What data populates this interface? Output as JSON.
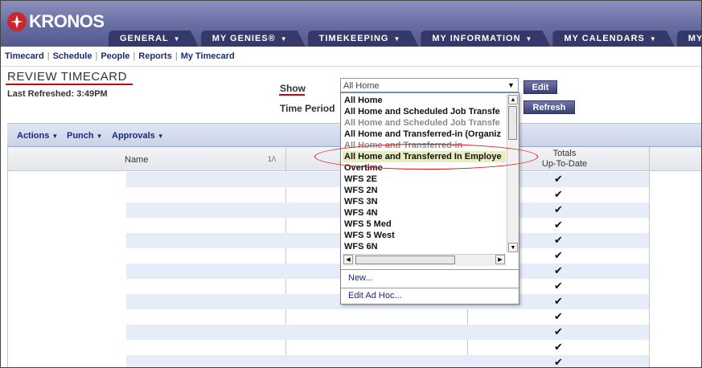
{
  "header": {
    "logo_text": "KRONOS",
    "tabs": [
      {
        "label": "GENERAL"
      },
      {
        "label": "MY GENIES®"
      },
      {
        "label": "TIMEKEEPING"
      },
      {
        "label": "MY INFORMATION"
      },
      {
        "label": "MY CALENDARS"
      },
      {
        "label": "MY LINKS"
      }
    ]
  },
  "subnav": {
    "links": [
      "Timecard",
      "Schedule",
      "People",
      "Reports",
      "My Timecard"
    ]
  },
  "page": {
    "title": "REVIEW TIMECARD",
    "last_refreshed": "Last Refreshed: 3:49PM",
    "show_label": "Show",
    "time_period_label": "Time Period",
    "show_value": "All Home",
    "edit_button": "Edit",
    "refresh_button": "Refresh"
  },
  "toolbar": {
    "actions": "Actions",
    "punch": "Punch",
    "approvals": "Approvals"
  },
  "grid": {
    "name_header": "Name",
    "sort_indicator": "1/\\",
    "totals_line1": "Totals",
    "totals_line2": "Up-To-Date",
    "check_glyph": "✔"
  },
  "dropdown": {
    "items": [
      {
        "label": "All Home",
        "state": "normal"
      },
      {
        "label": "All Home and Scheduled Job Transfe",
        "state": "normal"
      },
      {
        "label": "All Home and Scheduled Job Transfe",
        "state": "dim"
      },
      {
        "label": "All Home and Transferred-in (Organiz",
        "state": "normal"
      },
      {
        "label": "All Home and Transferred-in",
        "state": "dim"
      },
      {
        "label": "All Home and Transferred In Employe",
        "state": "selected"
      },
      {
        "label": "Overtime",
        "state": "normal"
      },
      {
        "label": "WFS 2E",
        "state": "normal"
      },
      {
        "label": "WFS 2N",
        "state": "normal"
      },
      {
        "label": "WFS 3N",
        "state": "normal"
      },
      {
        "label": "WFS 4N",
        "state": "normal"
      },
      {
        "label": "WFS 5 Med",
        "state": "normal"
      },
      {
        "label": "WFS 5 West",
        "state": "normal"
      },
      {
        "label": "WFS 6N",
        "state": "normal"
      }
    ],
    "new_label": "New...",
    "edit_adhoc_label": "Edit Ad Hoc..."
  },
  "colors": {
    "header_bg": "#666c9f",
    "tab_bg": "#34386a",
    "link": "#1a2a7a",
    "row_band": "#e6ecf8",
    "annotation_red": "#e01010"
  }
}
